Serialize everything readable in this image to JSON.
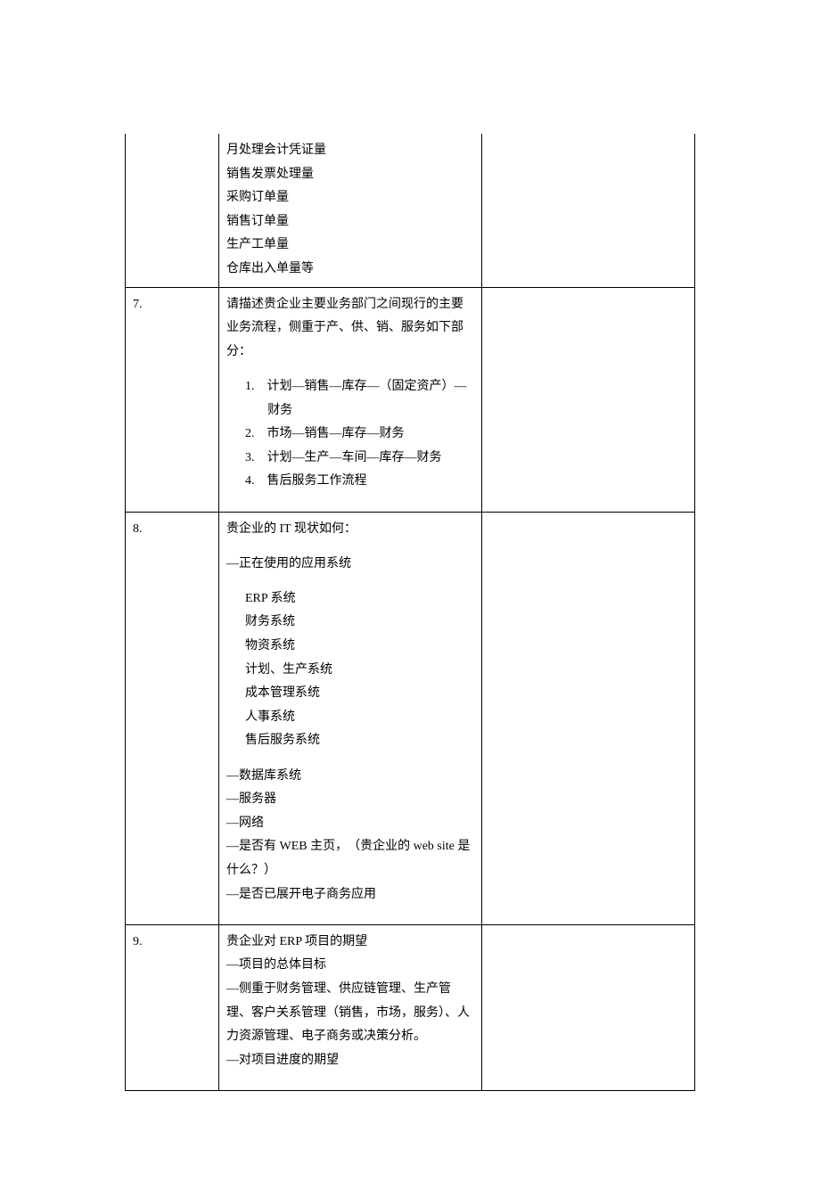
{
  "rows": {
    "r6": {
      "num": "",
      "lines": [
        "月处理会计凭证量",
        "销售发票处理量",
        "采购订单量",
        "销售订单量",
        "生产工单量",
        "仓库出入单量等"
      ]
    },
    "r7": {
      "num": "7.",
      "intro": "请描述贵企业主要业务部门之间现行的主要业务流程，侧重于产、供、销、服务如下部分：",
      "list": [
        "1.　计划—销售—库存—（固定资产）—财务",
        "2.　市场—销售—库存—财务",
        "3.　计划—生产—车间—库存—财务",
        "4.　售后服务工作流程"
      ]
    },
    "r8": {
      "num": "8.",
      "l1": "贵企业的 IT 现状如何：",
      "l2": "—正在使用的应用系统",
      "sys": [
        "ERP 系统",
        "财务系统",
        "物资系统",
        "计划、生产系统",
        "成本管理系统",
        "人事系统",
        "售后服务系统"
      ],
      "l3": "—数据库系统",
      "l4": "—服务器",
      "l5": "—网络",
      "l6": "—是否有 WEB 主页，　（贵企业的 web site 是什么？）",
      "l7": "—是否已展开电子商务应用"
    },
    "r9": {
      "num": "9.",
      "l1": "贵企业对 ERP 项目的期望",
      "l2": "—项目的总体目标",
      "l3": "—侧重于财务管理、供应链管理、生产管理、客户关系管理（销售，市场，服务）、人力资源管理、电子商务或决策分析。",
      "l4": "—对项目进度的期望"
    }
  }
}
